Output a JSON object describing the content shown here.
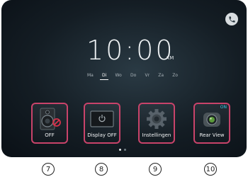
{
  "clock": {
    "time": "10:00",
    "meridiem": "AM",
    "days": [
      "Ma",
      "Di",
      "Wo",
      "Do",
      "Vr",
      "Za",
      "Zo"
    ],
    "active_day": "Di"
  },
  "tiles": [
    {
      "label": "OFF",
      "icon": "speaker-mute-icon",
      "callout": "7"
    },
    {
      "label": "Display OFF",
      "icon": "display-power-icon",
      "callout": "8"
    },
    {
      "label": "Instellingen",
      "icon": "gear-icon",
      "callout": "9"
    },
    {
      "label": "Rear View",
      "icon": "camera-icon",
      "status": "ON",
      "callout": "10"
    }
  ],
  "accent_color": "#c9436a"
}
